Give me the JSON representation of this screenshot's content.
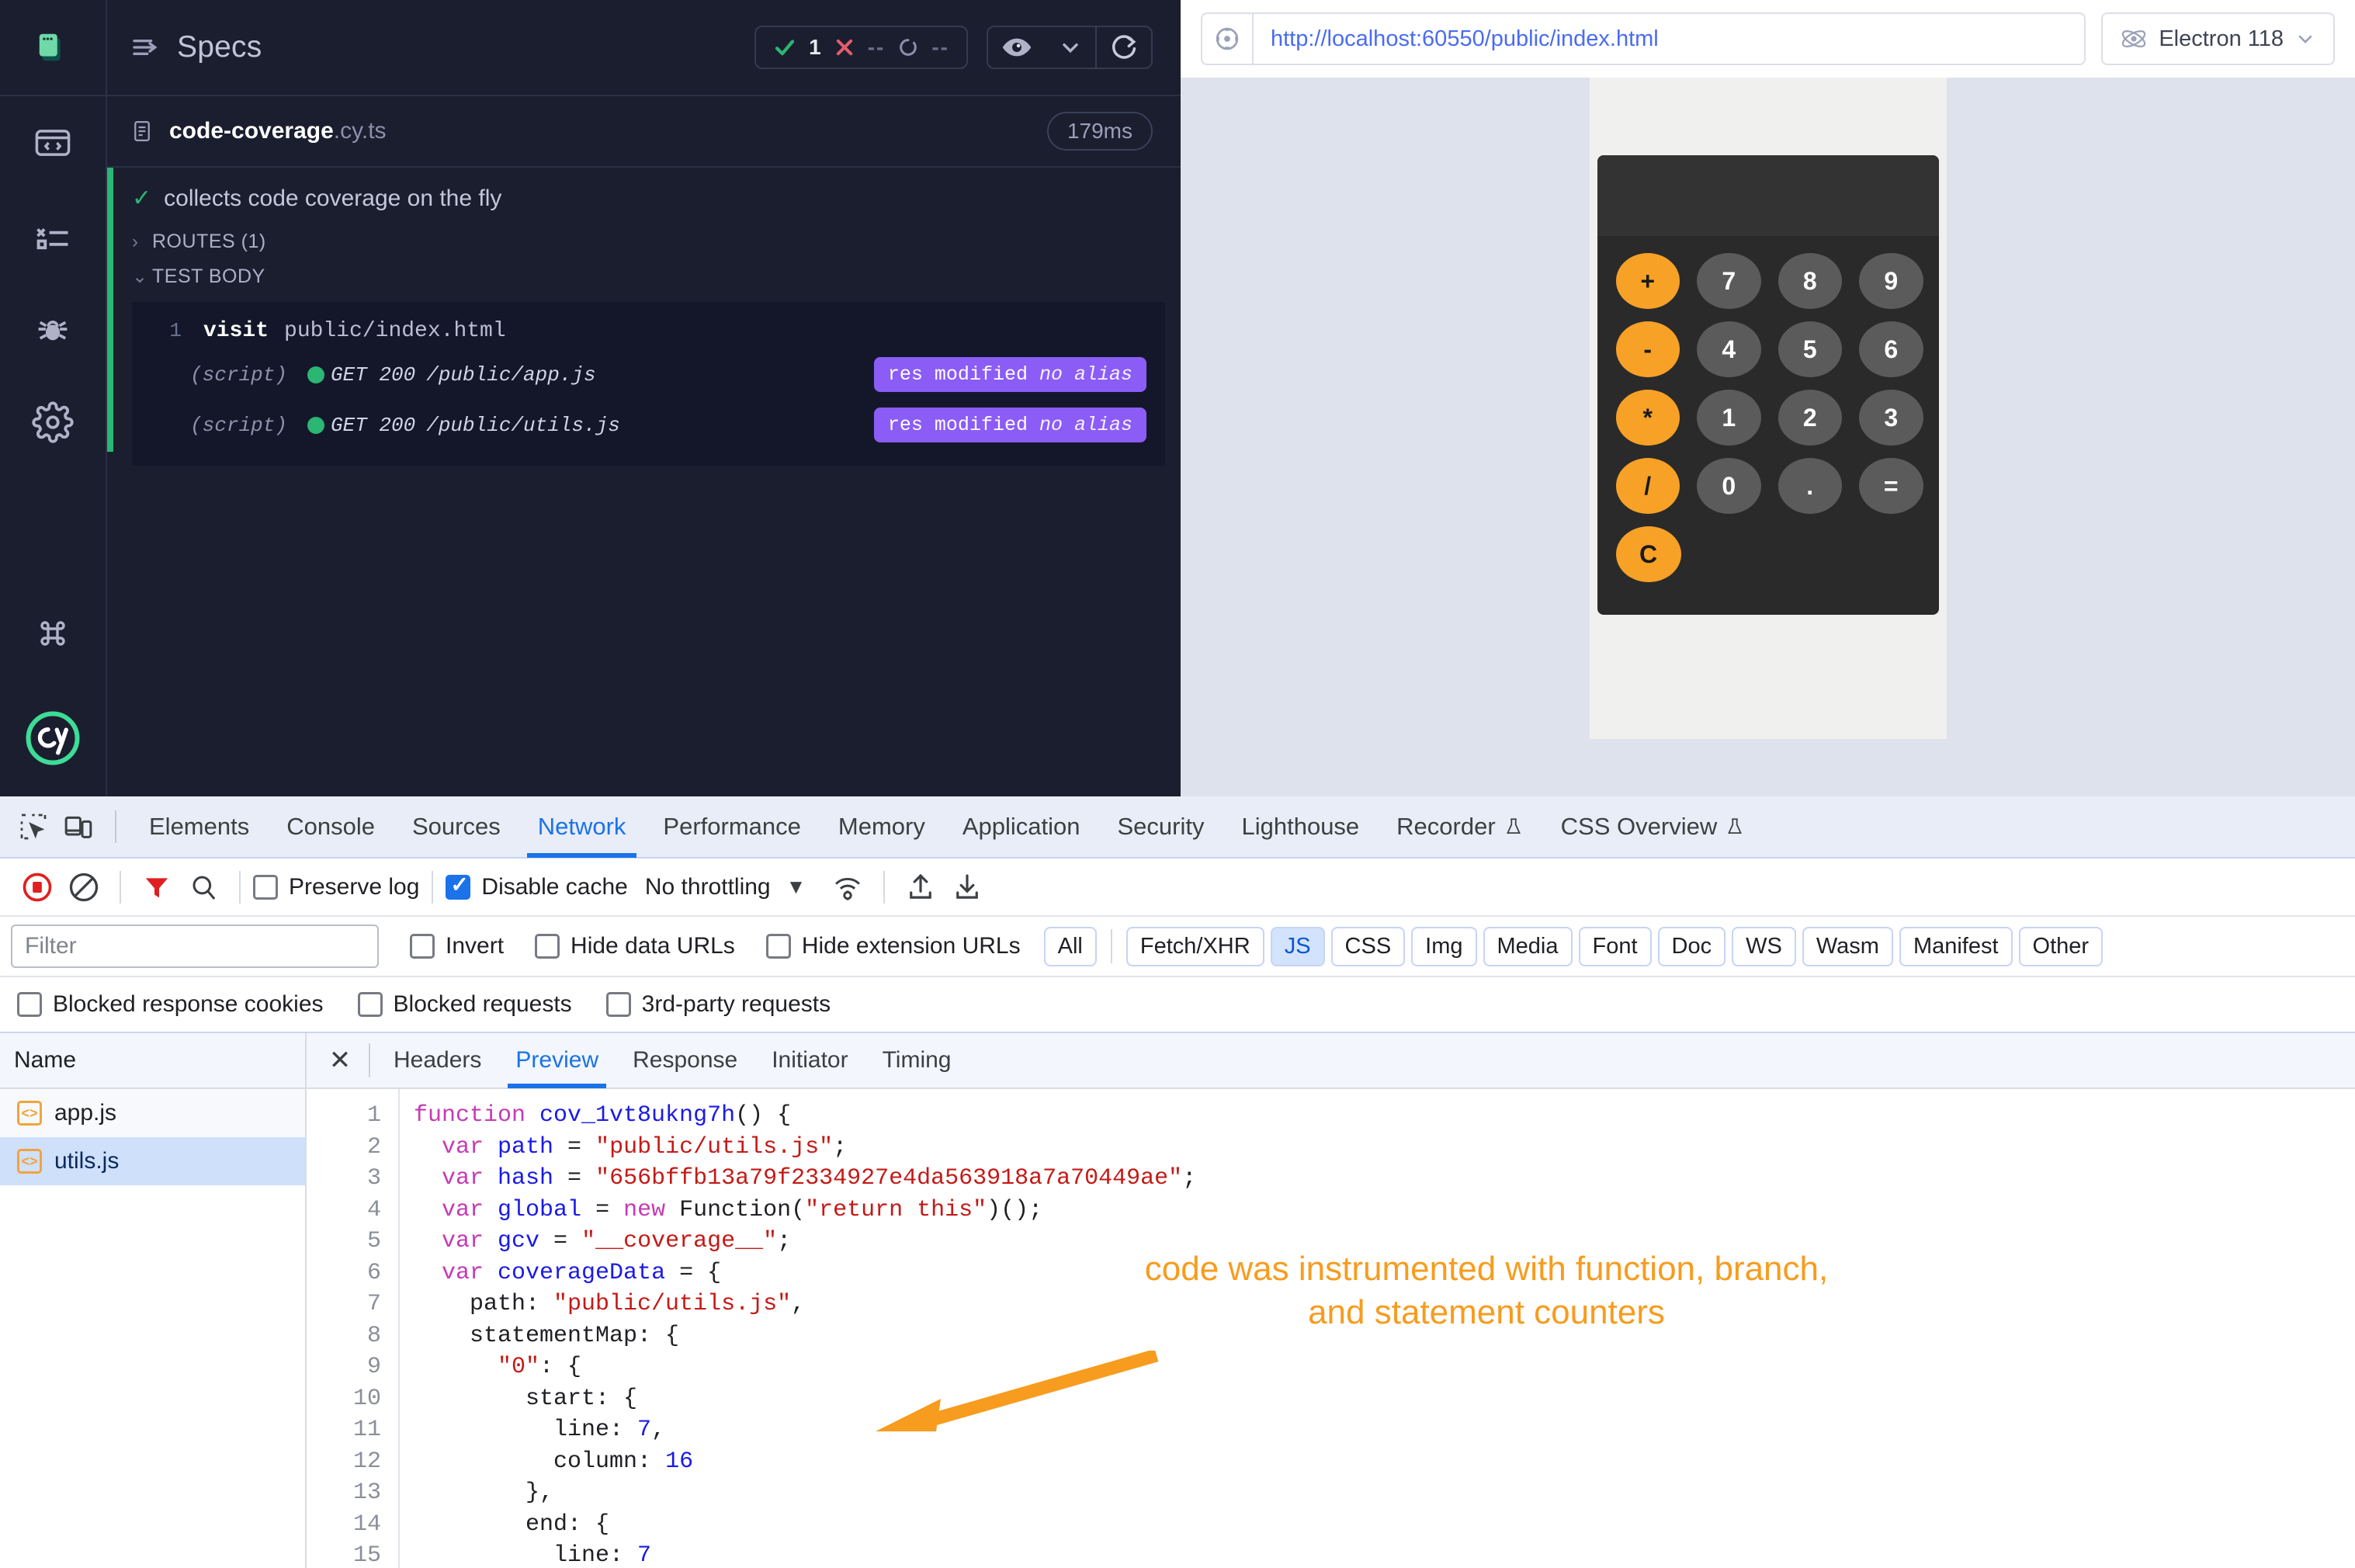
{
  "cypress": {
    "sidebar_icons": [
      {
        "name": "cypress-specs-logo",
        "label": "Specs logo"
      },
      {
        "name": "code-window-icon",
        "label": "Specs"
      },
      {
        "name": "runs-icon",
        "label": "Runs"
      },
      {
        "name": "debug-bug-icon",
        "label": "Debug"
      },
      {
        "name": "settings-gear-icon",
        "label": "Settings"
      },
      {
        "name": "keyboard-shortcuts-icon",
        "label": "Keyboard shortcuts"
      },
      {
        "name": "cypress-cy-logo",
        "label": "cy"
      }
    ],
    "header": {
      "title": "Specs",
      "stats": {
        "passed": "1",
        "failed": "--",
        "pending": "--"
      },
      "buttons": {
        "viewport": "eye-icon",
        "viewport_caret": "chevron-down-icon",
        "reload": "reload-icon"
      }
    },
    "spec": {
      "file_base": "code-coverage",
      "file_ext": ".cy.ts",
      "duration": "179ms"
    },
    "test": {
      "title": "collects code coverage on the fly",
      "groups": [
        {
          "label": "ROUTES (1)",
          "expanded": false
        },
        {
          "label": "TEST BODY",
          "expanded": true
        }
      ],
      "commands": [
        {
          "num": "1",
          "keyword": "visit",
          "arg": "public/index.html"
        }
      ],
      "requests": [
        {
          "type": "(script)",
          "method_status": "GET 200",
          "url": "/public/app.js",
          "badge_main": "res modified",
          "badge_alias": "no alias",
          "status_color": "#2bb673"
        },
        {
          "type": "(script)",
          "method_status": "GET 200",
          "url": "/public/utils.js",
          "badge_main": "res modified",
          "badge_alias": "no alias",
          "status_color": "#2bb673"
        }
      ]
    }
  },
  "aut": {
    "url": "http://localhost:60550/public/index.html",
    "url_placeholder": "http://localhost:60550/public/index.html",
    "selector_icon": "selector-playground-icon",
    "browser": "Electron 118",
    "browser_caret": "chevron-down-icon",
    "calculator": {
      "display_value": "",
      "rows": [
        [
          {
            "label": "+",
            "kind": "op"
          },
          {
            "label": "7",
            "kind": "num"
          },
          {
            "label": "8",
            "kind": "num"
          },
          {
            "label": "9",
            "kind": "num"
          }
        ],
        [
          {
            "label": "-",
            "kind": "op"
          },
          {
            "label": "4",
            "kind": "num"
          },
          {
            "label": "5",
            "kind": "num"
          },
          {
            "label": "6",
            "kind": "num"
          }
        ],
        [
          {
            "label": "*",
            "kind": "op"
          },
          {
            "label": "1",
            "kind": "num"
          },
          {
            "label": "2",
            "kind": "num"
          },
          {
            "label": "3",
            "kind": "num"
          }
        ],
        [
          {
            "label": "/",
            "kind": "op"
          },
          {
            "label": "0",
            "kind": "num"
          },
          {
            "label": ".",
            "kind": "num"
          },
          {
            "label": "=",
            "kind": "num"
          }
        ],
        [
          {
            "label": "C",
            "kind": "op"
          }
        ]
      ]
    }
  },
  "devtools": {
    "left_icons": [
      "inspect-element-icon",
      "device-toolbar-icon"
    ],
    "tabs": [
      {
        "label": "Elements",
        "active": false,
        "flask": false
      },
      {
        "label": "Console",
        "active": false,
        "flask": false
      },
      {
        "label": "Sources",
        "active": false,
        "flask": false
      },
      {
        "label": "Network",
        "active": true,
        "flask": false
      },
      {
        "label": "Performance",
        "active": false,
        "flask": false
      },
      {
        "label": "Memory",
        "active": false,
        "flask": false
      },
      {
        "label": "Application",
        "active": false,
        "flask": false
      },
      {
        "label": "Security",
        "active": false,
        "flask": false
      },
      {
        "label": "Lighthouse",
        "active": false,
        "flask": false
      },
      {
        "label": "Recorder",
        "active": false,
        "flask": true
      },
      {
        "label": "CSS Overview",
        "active": false,
        "flask": true
      }
    ],
    "toolbar": {
      "record_icon": "record-stop-icon",
      "clear_icon": "clear-network-icon",
      "filter_icon": "filter-funnel-icon",
      "search_icon": "search-icon",
      "preserve_log": {
        "label": "Preserve log",
        "checked": false
      },
      "disable_cache": {
        "label": "Disable cache",
        "checked": true
      },
      "throttling": "No throttling",
      "throttling_caret": "chevron-down-icon",
      "network_conditions_icon": "network-conditions-icon",
      "import_har_icon": "import-har-icon",
      "export_har_icon": "export-har-icon"
    },
    "filterbar": {
      "filter_placeholder": "Filter",
      "filter_value": "",
      "invert": {
        "label": "Invert",
        "checked": false
      },
      "hide_data_urls": {
        "label": "Hide data URLs",
        "checked": false
      },
      "hide_extension_urls": {
        "label": "Hide extension URLs",
        "checked": false
      },
      "types": [
        {
          "label": "All",
          "selected": false
        },
        {
          "label": "Fetch/XHR",
          "selected": false
        },
        {
          "label": "JS",
          "selected": true
        },
        {
          "label": "CSS",
          "selected": false
        },
        {
          "label": "Img",
          "selected": false
        },
        {
          "label": "Media",
          "selected": false
        },
        {
          "label": "Font",
          "selected": false
        },
        {
          "label": "Doc",
          "selected": false
        },
        {
          "label": "WS",
          "selected": false
        },
        {
          "label": "Wasm",
          "selected": false
        },
        {
          "label": "Manifest",
          "selected": false
        },
        {
          "label": "Other",
          "selected": false
        }
      ]
    },
    "checkbar": [
      {
        "label": "Blocked response cookies",
        "checked": false
      },
      {
        "label": "Blocked requests",
        "checked": false
      },
      {
        "label": "3rd-party requests",
        "checked": false
      }
    ],
    "request_list": {
      "column_header": "Name",
      "rows": [
        {
          "name": "app.js",
          "selected": false,
          "icon": "js-file-icon"
        },
        {
          "name": "utils.js",
          "selected": true,
          "icon": "js-file-icon"
        }
      ]
    },
    "detail": {
      "close_label": "✕",
      "tabs": [
        {
          "label": "Headers",
          "active": false
        },
        {
          "label": "Preview",
          "active": true
        },
        {
          "label": "Response",
          "active": false
        },
        {
          "label": "Initiator",
          "active": false
        },
        {
          "label": "Timing",
          "active": false
        }
      ],
      "preview_code": {
        "line_numbers": [
          "1",
          "2",
          "3",
          "4",
          "5",
          "6",
          "7",
          "8",
          "9",
          "10",
          "11",
          "12",
          "13",
          "14",
          "15"
        ],
        "lines": [
          [
            {
              "t": "function ",
              "c": "kw"
            },
            {
              "t": "cov_1vt8ukng7h",
              "c": "fn"
            },
            {
              "t": "() {",
              "c": "pl"
            }
          ],
          [
            {
              "t": "  ",
              "c": "pl"
            },
            {
              "t": "var ",
              "c": "kw"
            },
            {
              "t": "path",
              "c": "var"
            },
            {
              "t": " = ",
              "c": "pl"
            },
            {
              "t": "\"public/utils.js\"",
              "c": "str"
            },
            {
              "t": ";",
              "c": "pl"
            }
          ],
          [
            {
              "t": "  ",
              "c": "pl"
            },
            {
              "t": "var ",
              "c": "kw"
            },
            {
              "t": "hash",
              "c": "var"
            },
            {
              "t": " = ",
              "c": "pl"
            },
            {
              "t": "\"656bffb13a79f2334927e4da563918a7a70449ae\"",
              "c": "str"
            },
            {
              "t": ";",
              "c": "pl"
            }
          ],
          [
            {
              "t": "  ",
              "c": "pl"
            },
            {
              "t": "var ",
              "c": "kw"
            },
            {
              "t": "global",
              "c": "var"
            },
            {
              "t": " = ",
              "c": "pl"
            },
            {
              "t": "new ",
              "c": "kw"
            },
            {
              "t": "Function(",
              "c": "pl"
            },
            {
              "t": "\"return this\"",
              "c": "str"
            },
            {
              "t": ")();",
              "c": "pl"
            }
          ],
          [
            {
              "t": "  ",
              "c": "pl"
            },
            {
              "t": "var ",
              "c": "kw"
            },
            {
              "t": "gcv",
              "c": "var"
            },
            {
              "t": " = ",
              "c": "pl"
            },
            {
              "t": "\"__coverage__\"",
              "c": "str"
            },
            {
              "t": ";",
              "c": "pl"
            }
          ],
          [
            {
              "t": "  ",
              "c": "pl"
            },
            {
              "t": "var ",
              "c": "kw"
            },
            {
              "t": "coverageData",
              "c": "var"
            },
            {
              "t": " = {",
              "c": "pl"
            }
          ],
          [
            {
              "t": "    path: ",
              "c": "pl"
            },
            {
              "t": "\"public/utils.js\"",
              "c": "str"
            },
            {
              "t": ",",
              "c": "pl"
            }
          ],
          [
            {
              "t": "    statementMap: {",
              "c": "pl"
            }
          ],
          [
            {
              "t": "      ",
              "c": "pl"
            },
            {
              "t": "\"0\"",
              "c": "str"
            },
            {
              "t": ": {",
              "c": "pl"
            }
          ],
          [
            {
              "t": "        start: {",
              "c": "pl"
            }
          ],
          [
            {
              "t": "          line: ",
              "c": "pl"
            },
            {
              "t": "7",
              "c": "num"
            },
            {
              "t": ",",
              "c": "pl"
            }
          ],
          [
            {
              "t": "          column: ",
              "c": "pl"
            },
            {
              "t": "16",
              "c": "num"
            }
          ],
          [
            {
              "t": "        },",
              "c": "pl"
            }
          ],
          [
            {
              "t": "        end: {",
              "c": "pl"
            }
          ],
          [
            {
              "t": "          line: ",
              "c": "pl"
            },
            {
              "t": "7",
              "c": "num"
            }
          ]
        ]
      }
    }
  },
  "annotation": {
    "text": "code was instrumented with function, branch, and statement counters",
    "color": "#f79c1e",
    "arrow": "orange-arrow-pointing-left"
  }
}
